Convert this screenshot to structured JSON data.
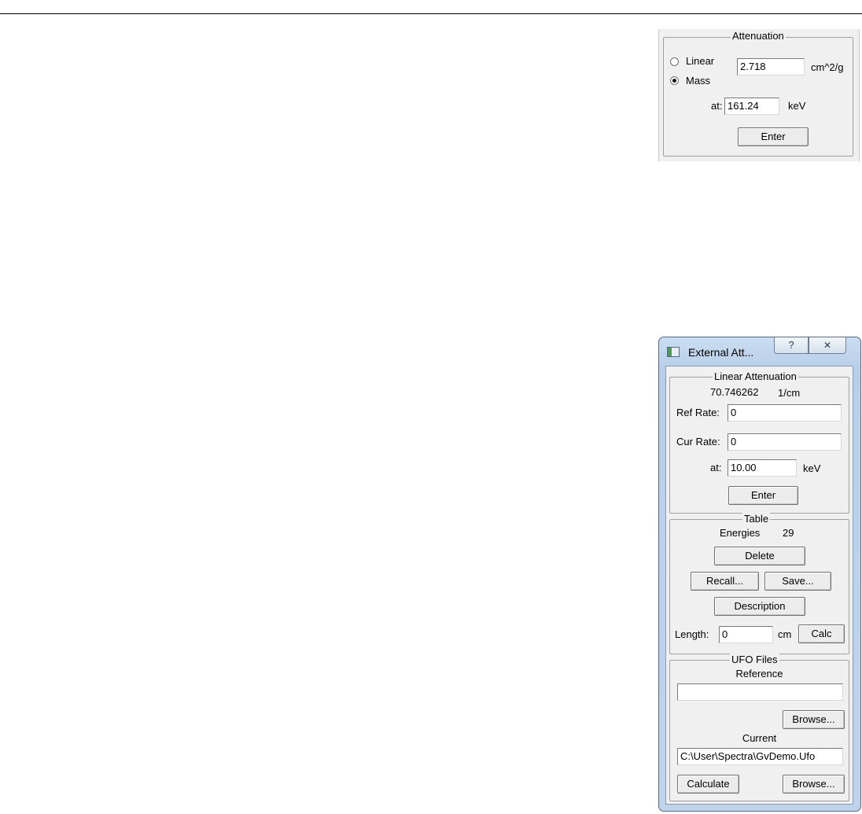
{
  "attenuation_panel": {
    "title": "Attenuation",
    "radio_linear": "Linear",
    "radio_mass": "Mass",
    "selected": "Mass",
    "coefficient_value": "2.718",
    "coefficient_unit": "cm^2/g",
    "at_label": "at:",
    "energy_value": "161.24",
    "energy_unit": "keV",
    "enter_label": "Enter"
  },
  "external_dialog": {
    "title": "External Att...",
    "help_label": "?",
    "close_label": "✕",
    "linear_attenuation": {
      "title": "Linear Attenuation",
      "value": "70.746262",
      "unit": "1/cm",
      "ref_rate_label": "Ref Rate:",
      "ref_rate_value": "0",
      "cur_rate_label": "Cur Rate:",
      "cur_rate_value": "0",
      "at_label": "at:",
      "energy_value": "10.00",
      "energy_unit": "keV",
      "enter_label": "Enter"
    },
    "table": {
      "title": "Table",
      "energies_label": "Energies",
      "energies_count": "29",
      "delete_label": "Delete",
      "recall_label": "Recall...",
      "save_label": "Save...",
      "description_label": "Description",
      "length_label": "Length:",
      "length_value": "0",
      "length_unit": "cm",
      "calc_label": "Calc"
    },
    "ufo_files": {
      "title": "UFO Files",
      "reference_label": "Reference",
      "reference_value": "",
      "browse_label": "Browse...",
      "current_label": "Current",
      "current_value": "C:\\User\\Spectra\\GvDemo.Ufo",
      "calculate_label": "Calculate",
      "browse2_label": "Browse..."
    }
  }
}
